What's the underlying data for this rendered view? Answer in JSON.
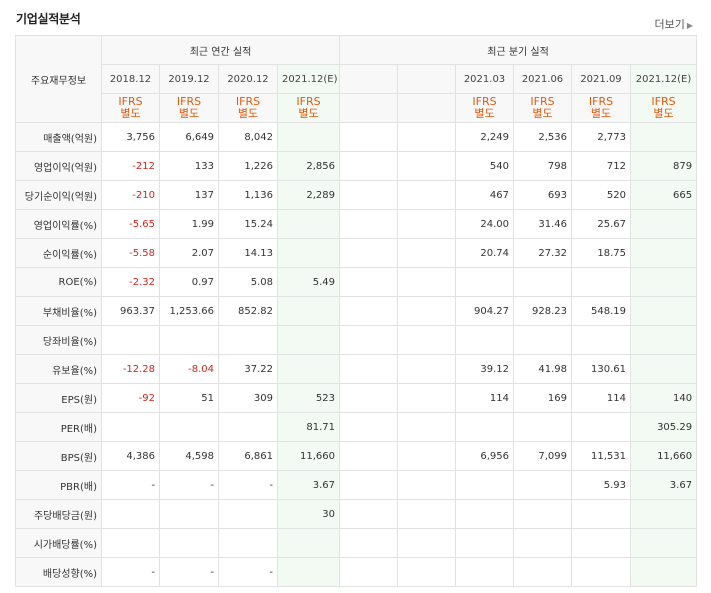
{
  "section_title": "기업실적분석",
  "more_label": "더보기",
  "header": {
    "row_label": "주요재무정보",
    "annual_group": "최근 연간 실적",
    "quarter_group": "최근 분기 실적",
    "annual_periods": [
      "2018.12",
      "2019.12",
      "2020.12",
      "2021.12(E)"
    ],
    "quarter_periods": [
      "",
      "",
      "2021.03",
      "2021.06",
      "2021.09",
      "2021.12(E)"
    ],
    "ifrs_line1": "IFRS",
    "ifrs_line2": "별도"
  },
  "rows": [
    {
      "label": "매출액(억원)",
      "annual": [
        "3,756",
        "6,649",
        "8,042",
        ""
      ],
      "quarter": [
        "",
        "",
        "2,249",
        "2,536",
        "2,773",
        ""
      ]
    },
    {
      "label": "영업이익(억원)",
      "annual": [
        "-212",
        "133",
        "1,226",
        "2,856"
      ],
      "quarter": [
        "",
        "",
        "540",
        "798",
        "712",
        "879"
      ]
    },
    {
      "label": "당기순이익(억원)",
      "annual": [
        "-210",
        "137",
        "1,136",
        "2,289"
      ],
      "quarter": [
        "",
        "",
        "467",
        "693",
        "520",
        "665"
      ]
    },
    {
      "label": "영업이익률(%)",
      "annual": [
        "-5.65",
        "1.99",
        "15.24",
        ""
      ],
      "quarter": [
        "",
        "",
        "24.00",
        "31.46",
        "25.67",
        ""
      ]
    },
    {
      "label": "순이익률(%)",
      "annual": [
        "-5.58",
        "2.07",
        "14.13",
        ""
      ],
      "quarter": [
        "",
        "",
        "20.74",
        "27.32",
        "18.75",
        ""
      ]
    },
    {
      "label": "ROE(%)",
      "annual": [
        "-2.32",
        "0.97",
        "5.08",
        "5.49"
      ],
      "quarter": [
        "",
        "",
        "",
        "",
        "",
        ""
      ]
    },
    {
      "label": "부채비율(%)",
      "annual": [
        "963.37",
        "1,253.66",
        "852.82",
        ""
      ],
      "quarter": [
        "",
        "",
        "904.27",
        "928.23",
        "548.19",
        ""
      ]
    },
    {
      "label": "당좌비율(%)",
      "annual": [
        "",
        "",
        "",
        ""
      ],
      "quarter": [
        "",
        "",
        "",
        "",
        "",
        ""
      ]
    },
    {
      "label": "유보율(%)",
      "annual": [
        "-12.28",
        "-8.04",
        "37.22",
        ""
      ],
      "quarter": [
        "",
        "",
        "39.12",
        "41.98",
        "130.61",
        ""
      ]
    },
    {
      "label": "EPS(원)",
      "annual": [
        "-92",
        "51",
        "309",
        "523"
      ],
      "quarter": [
        "",
        "",
        "114",
        "169",
        "114",
        "140"
      ]
    },
    {
      "label": "PER(배)",
      "annual": [
        "",
        "",
        "",
        "81.71"
      ],
      "quarter": [
        "",
        "",
        "",
        "",
        "",
        "305.29"
      ]
    },
    {
      "label": "BPS(원)",
      "annual": [
        "4,386",
        "4,598",
        "6,861",
        "11,660"
      ],
      "quarter": [
        "",
        "",
        "6,956",
        "7,099",
        "11,531",
        "11,660"
      ]
    },
    {
      "label": "PBR(배)",
      "annual": [
        "-",
        "-",
        "-",
        "3.67"
      ],
      "quarter": [
        "",
        "",
        "",
        "",
        "5.93",
        "3.67"
      ]
    },
    {
      "label": "주당배당금(원)",
      "annual": [
        "",
        "",
        "",
        "30"
      ],
      "quarter": [
        "",
        "",
        "",
        "",
        "",
        ""
      ]
    },
    {
      "label": "시가배당률(%)",
      "annual": [
        "",
        "",
        "",
        ""
      ],
      "quarter": [
        "",
        "",
        "",
        "",
        "",
        ""
      ]
    },
    {
      "label": "배당성향(%)",
      "annual": [
        "-",
        "-",
        "-",
        ""
      ],
      "quarter": [
        "",
        "",
        "",
        "",
        "",
        ""
      ]
    }
  ],
  "colors": {
    "negative": "#d0241b",
    "ifrs": "#e35a0b",
    "estimate_bg": "#f3f9f3"
  }
}
